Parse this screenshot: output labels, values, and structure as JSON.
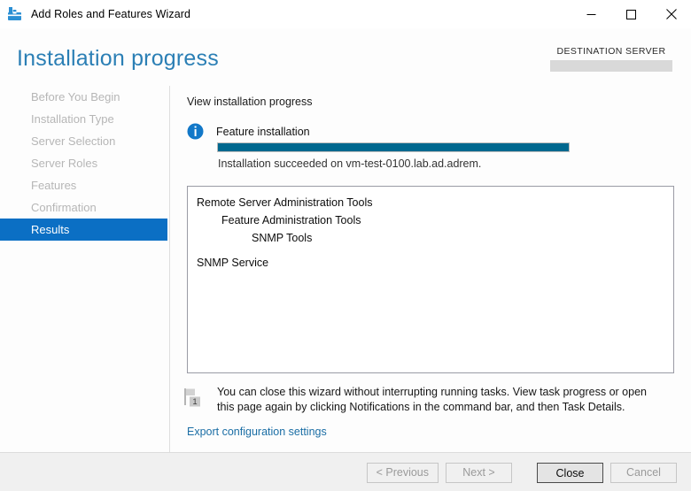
{
  "window": {
    "title": "Add Roles and Features Wizard",
    "app_icon": "toolbox-icon",
    "controls": {
      "minimize": "minimize-icon",
      "maximize": "maximize-icon",
      "close": "close-icon"
    }
  },
  "header": {
    "page_title": "Installation progress",
    "destination_label": "DESTINATION SERVER",
    "destination_value": "",
    "title_color": "#2b7fb5"
  },
  "sidebar": {
    "items": [
      {
        "label": "Before You Begin",
        "active": false
      },
      {
        "label": "Installation Type",
        "active": false
      },
      {
        "label": "Server Selection",
        "active": false
      },
      {
        "label": "Server Roles",
        "active": false
      },
      {
        "label": "Features",
        "active": false
      },
      {
        "label": "Confirmation",
        "active": false
      },
      {
        "label": "Results",
        "active": true
      }
    ],
    "active_color": "#0b6fc4",
    "disabled_color": "#b6b6b6"
  },
  "main": {
    "section_label": "View installation progress",
    "status_icon": "info-icon",
    "status_heading": "Feature installation",
    "progress": {
      "percent": 100,
      "fill_color": "#00688f"
    },
    "status_message": "Installation succeeded on vm-test-0100.lab.ad.adrem.",
    "results": [
      {
        "text": "Remote Server Administration Tools",
        "indent": 0
      },
      {
        "text": "Feature Administration Tools",
        "indent": 1
      },
      {
        "text": "SNMP Tools",
        "indent": 2
      },
      {
        "text": "SNMP Service",
        "indent": 0,
        "gap": true
      }
    ],
    "notice": {
      "icon": "notification-flag-icon",
      "badge": "1",
      "text": "You can close this wizard without interrupting running tasks. View task progress or open this page again by clicking Notifications in the command bar, and then Task Details."
    },
    "export_link": "Export configuration settings",
    "link_color": "#1b6ea5"
  },
  "footer": {
    "buttons": [
      {
        "label": "< Previous",
        "state": "disabled"
      },
      {
        "label": "Next >",
        "state": "disabled"
      },
      {
        "label": "Close",
        "state": "default"
      },
      {
        "label": "Cancel",
        "state": "disabled"
      }
    ]
  }
}
